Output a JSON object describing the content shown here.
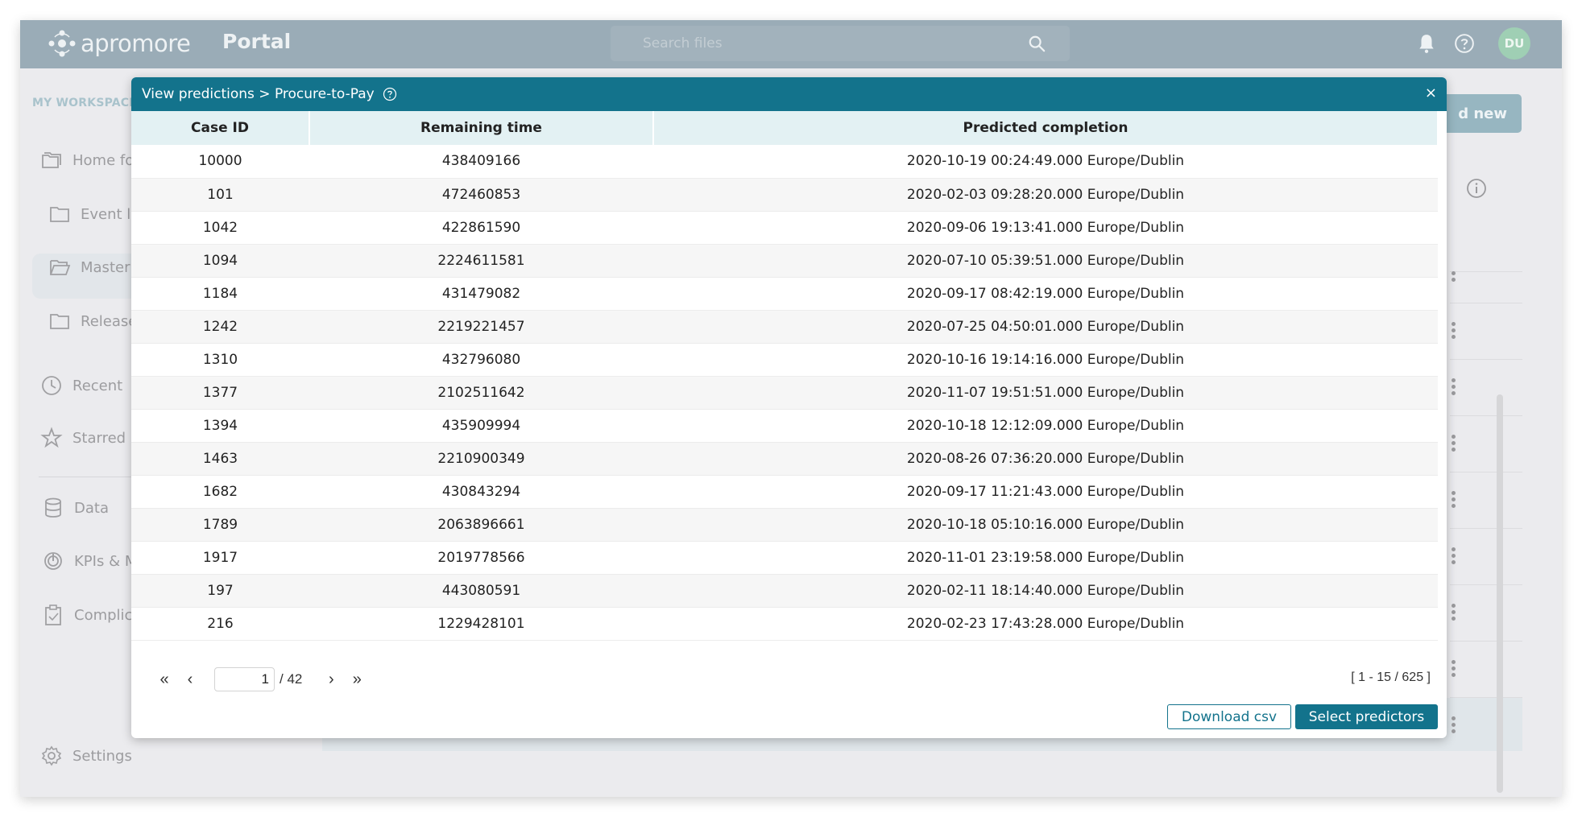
{
  "header": {
    "logo_text": "apromore",
    "portal_label": "Portal",
    "search_placeholder": "Search files",
    "search_value": "",
    "avatar_initials": "DU"
  },
  "sidebar": {
    "section_title": "MY WORKSPACE",
    "folders": [
      {
        "label": "Home fo",
        "icon": "folders-icon"
      },
      {
        "label": "Event lo",
        "icon": "folder-icon"
      },
      {
        "label": "Master",
        "icon": "folder-open-icon",
        "selected": true
      },
      {
        "label": "Release",
        "icon": "folder-icon"
      }
    ],
    "items": [
      {
        "label": "Recent",
        "icon": "clock-icon"
      },
      {
        "label": "Starred",
        "icon": "star-icon"
      },
      {
        "label": "Data",
        "icon": "database-icon"
      },
      {
        "label": "KPIs & M",
        "icon": "target-icon"
      },
      {
        "label": "Complic",
        "icon": "clipboard-check-icon"
      }
    ],
    "settings_label": "Settings"
  },
  "background": {
    "add_new_label": "d new"
  },
  "modal": {
    "title": "View predictions > Procure-to-Pay",
    "close_label": "×",
    "columns": [
      "Case ID",
      "Remaining time",
      "Predicted completion"
    ],
    "rows": [
      [
        "10000",
        "438409166",
        "2020-10-19 00:24:49.000 Europe/Dublin"
      ],
      [
        "101",
        "472460853",
        "2020-02-03 09:28:20.000 Europe/Dublin"
      ],
      [
        "1042",
        "422861590",
        "2020-09-06 19:13:41.000 Europe/Dublin"
      ],
      [
        "1094",
        "2224611581",
        "2020-07-10 05:39:51.000 Europe/Dublin"
      ],
      [
        "1184",
        "431479082",
        "2020-09-17 08:42:19.000 Europe/Dublin"
      ],
      [
        "1242",
        "2219221457",
        "2020-07-25 04:50:01.000 Europe/Dublin"
      ],
      [
        "1310",
        "432796080",
        "2020-10-16 19:14:16.000 Europe/Dublin"
      ],
      [
        "1377",
        "2102511642",
        "2020-11-07 19:51:51.000 Europe/Dublin"
      ],
      [
        "1394",
        "435909994",
        "2020-10-18 12:12:09.000 Europe/Dublin"
      ],
      [
        "1463",
        "2210900349",
        "2020-08-26 07:36:20.000 Europe/Dublin"
      ],
      [
        "1682",
        "430843294",
        "2020-09-17 11:21:43.000 Europe/Dublin"
      ],
      [
        "1789",
        "2063896661",
        "2020-10-18 05:10:16.000 Europe/Dublin"
      ],
      [
        "1917",
        "2019778566",
        "2020-11-01 23:19:58.000 Europe/Dublin"
      ],
      [
        "197",
        "443080591",
        "2020-02-11 18:14:40.000 Europe/Dublin"
      ],
      [
        "216",
        "1229428101",
        "2020-02-23 17:43:28.000 Europe/Dublin"
      ]
    ],
    "pagination": {
      "first": "«",
      "prev": "‹",
      "current_page": "1",
      "total_pages_label": "/ 42",
      "next": "›",
      "last": "»",
      "range_label": "[ 1 - 15 / 625 ]"
    },
    "download_label": "Download csv",
    "select_predictors_label": "Select predictors"
  },
  "colors": {
    "accent": "#13738c",
    "topbar": "#9aacb7",
    "table_header": "#e3f1f3",
    "avatar": "#9fcfb4"
  }
}
